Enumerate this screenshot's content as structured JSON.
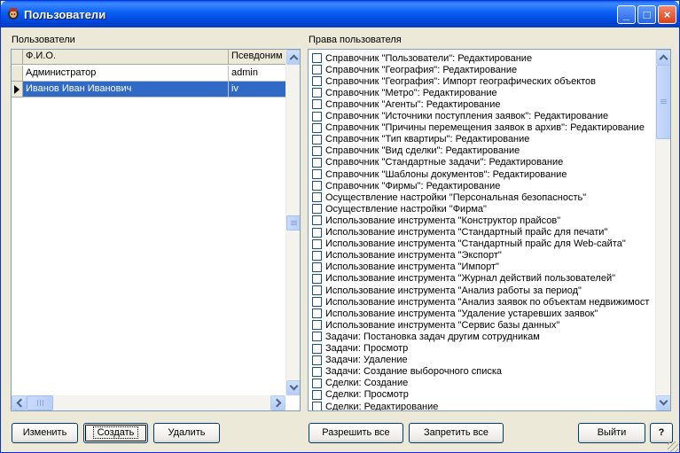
{
  "window": {
    "title": "Пользователи",
    "buttons": {
      "minimize": "_",
      "maximize": "□",
      "close": "×"
    }
  },
  "users": {
    "section_label": "Пользователи",
    "columns": [
      "Ф.И.О.",
      "Псевдоним"
    ],
    "rows": [
      {
        "name": "Администратор",
        "alias": "admin"
      },
      {
        "name": "Иванов Иван Иванович",
        "alias": "iv"
      }
    ],
    "selected_row": 1
  },
  "permissions": {
    "section_label": "Права пользователя",
    "items": [
      "Справочник \"Пользователи\": Редактирование",
      "Справочник \"География\": Редактирование",
      "Справочник \"География\": Импорт географических объектов",
      "Справочник \"Метро\": Редактирование",
      "Справочник \"Агенты\": Редактирование",
      "Справочник \"Источники поступления заявок\": Редактирование",
      "Справочник \"Причины перемещения заявок в архив\": Редактирование",
      "Справочник \"Тип квартиры\": Редактирование",
      "Справочник \"Вид сделки\": Редактирование",
      "Справочник \"Стандартные задачи\": Редактирование",
      "Справочник \"Шаблоны документов\": Редактирование",
      "Справочник \"Фирмы\": Редактирование",
      "Осуществление настройки \"Персональная безопасность\"",
      "Осуществление настройки \"Фирма\"",
      "Использование инструмента \"Конструктор прайсов\"",
      "Использование инструмента \"Стандартный прайс для печати\"",
      "Использование инструмента \"Стандартный прайс для Web-сайта\"",
      "Использование инструмента \"Экспорт\"",
      "Использование инструмента \"Импорт\"",
      "Использование инструмента \"Журнал действий пользователей\"",
      "Использование инструмента \"Анализ работы за период\"",
      "Использование инструмента \"Анализ заявок по объектам недвижимост",
      "Использование инструмента \"Удаление устаревших заявок\"",
      "Использование инструмента \"Сервис базы данных\"",
      "Задачи: Постановка задач другим сотрудникам",
      "Задачи: Просмотр",
      "Задачи: Удаление",
      "Задачи: Создание выборочного списка",
      "Сделки: Создание",
      "Сделки: Просмотр",
      "Сделки: Редактирование"
    ]
  },
  "buttons": {
    "edit": "Изменить",
    "create": "Создать",
    "delete": "Удалить",
    "allow_all": "Разрешить все",
    "deny_all": "Запретить все",
    "exit": "Выйти",
    "help": "?"
  }
}
